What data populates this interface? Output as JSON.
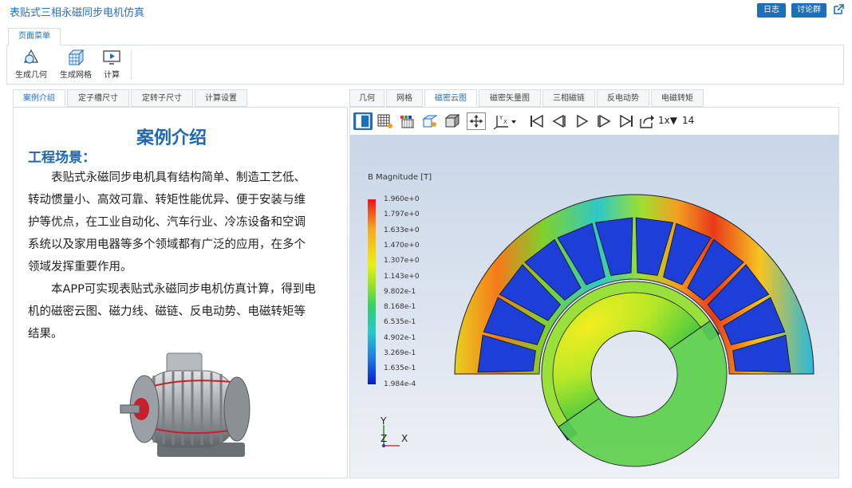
{
  "app": {
    "title": "表贴式三相永磁同步电机仿真"
  },
  "top_buttons": {
    "log": "日志",
    "discuss": "讨论群"
  },
  "ribbon": {
    "tab": "页面菜单",
    "buttons": [
      {
        "label": "生成几何",
        "icon": "geometry-icon"
      },
      {
        "label": "生成网格",
        "icon": "mesh-icon"
      },
      {
        "label": "计算",
        "icon": "compute-icon"
      }
    ]
  },
  "left_tabs": [
    "案例介绍",
    "定子槽尺寸",
    "定转子尺寸",
    "计算设置"
  ],
  "left_active_tab": 0,
  "intro": {
    "heading": "案例介绍",
    "subheading": "工程场景：",
    "para1": "表贴式永磁同步电机具有结构简单、制造工艺低、转动惯量小、高效可靠、转矩性能优异、便于安装与维护等优点，在工业自动化、汽车行业、冷冻设备和空调系统以及家用电器等多个领域都有广泛的应用，在多个领域发挥重要作用。",
    "para2": "本APP可实现表贴式永磁同步电机仿真计算，得到电机的磁密云图、磁力线、磁链、反电动势、电磁转矩等结果。"
  },
  "right_tabs": [
    "几何",
    "网格",
    "磁密云图",
    "磁密矢量图",
    "三相磁链",
    "反电动势",
    "电磁转矩"
  ],
  "right_active_tab": 2,
  "toolbar": {
    "speed": "1x▼",
    "frame": "14"
  },
  "legend": {
    "title": "B Magnitude [T]",
    "labels": [
      "1.960e+0",
      "1.797e+0",
      "1.633e+0",
      "1.470e+0",
      "1.307e+0",
      "1.143e+0",
      "9.802e-1",
      "8.168e-1",
      "6.535e-1",
      "4.902e-1",
      "3.269e-1",
      "1.635e-1",
      "1.984e-4"
    ]
  },
  "axes": {
    "y": "Y",
    "z": "Z",
    "x": "X"
  },
  "colors": {
    "accent": "#1f6fb7",
    "heading": "#2166b0"
  }
}
